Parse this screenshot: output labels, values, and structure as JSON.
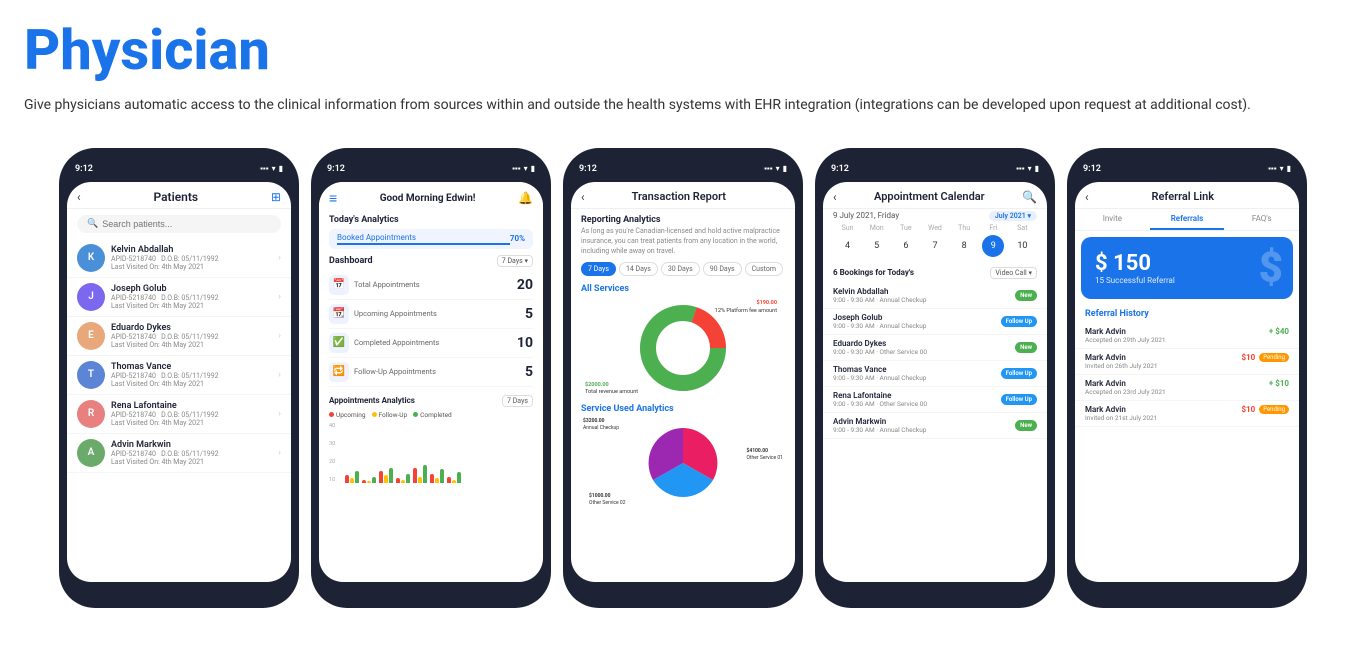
{
  "header": {
    "title": "Physician",
    "subtitle": "Give physicians automatic access to the clinical information from sources within and outside the health systems with EHR integration (integrations can be developed upon request at additional cost)."
  },
  "screens": [
    {
      "id": "patients",
      "time": "9:12",
      "title": "Patients",
      "search_placeholder": "Search patients...",
      "patients": [
        {
          "name": "Kelvin Abdallah",
          "id": "APID-5218740",
          "dob": "D.O.B: 05/11/1992",
          "last_visit": "Last Visited On: 4th May 2021",
          "color": "#4a90d9"
        },
        {
          "name": "Joseph Golub",
          "id": "APID-5218740",
          "dob": "D.O.B: 05/11/1992",
          "last_visit": "Last Visited On: 4th May 2021",
          "color": "#7b68ee"
        },
        {
          "name": "Eduardo Dykes",
          "id": "APID-5218740",
          "dob": "D.O.B: 05/11/1992",
          "last_visit": "Last Visited On: 4th May 2021",
          "color": "#e8a87c"
        },
        {
          "name": "Thomas Vance",
          "id": "APID-5218740",
          "dob": "D.O.B: 05/11/1992",
          "last_visit": "Last Visited On: 4th May 2021",
          "color": "#5c85d6"
        },
        {
          "name": "Rena Lafontaine",
          "id": "APID-5218740",
          "dob": "D.O.B: 05/11/1992",
          "last_visit": "Last Visited On: 4th May 2021",
          "color": "#e88080"
        },
        {
          "name": "Advin Markwin",
          "id": "APID-5218740",
          "dob": "D.O.B: 05/11/1992",
          "last_visit": "Last Visited On: 4th May 2021",
          "color": "#6aaa6a"
        }
      ]
    },
    {
      "id": "dashboard",
      "time": "9:12",
      "greeting": "Good Morning Edwin!",
      "analytics_title": "Today's Analytics",
      "booked_label": "Booked Appointments",
      "booked_pct": "70%",
      "dashboard_label": "Dashboard",
      "days_filter": "7 Days",
      "stats": [
        {
          "label": "Total Appointments",
          "value": "20",
          "icon": "📅"
        },
        {
          "label": "Upcoming Appointments",
          "value": "5",
          "icon": "📆"
        },
        {
          "label": "Completed Appointments",
          "value": "10",
          "icon": "✅"
        },
        {
          "label": "Follow-Up Appointments",
          "value": "5",
          "icon": "🔁"
        }
      ],
      "appointments_analytics_title": "Appointments Analytics",
      "appointments_days": "7 Days",
      "legend": [
        {
          "label": "Upcoming",
          "color": "#f44336"
        },
        {
          "label": "Follow-Up",
          "color": "#ffc107"
        },
        {
          "label": "Completed",
          "color": "#4caf50"
        }
      ],
      "y_axis": [
        "40",
        "30",
        "20",
        "10"
      ]
    },
    {
      "id": "transaction",
      "time": "9:12",
      "title": "Transaction Report",
      "reporting_label": "Reporting Analytics",
      "reporting_text": "As long as you're Canadian-licensed and hold active malpractice insurance, you can treat patients from any location in the world, including while away on travel.",
      "filter_tabs": [
        "7 Days",
        "14 Days",
        "30 Days",
        "90 Days",
        "Custom"
      ],
      "active_filter": "7 Days",
      "all_services_label": "All Services",
      "donut_labels": [
        {
          "text": "$190.00\n12% Platform fee amount",
          "pos": "top-right"
        },
        {
          "text": "$2000.00\nTotal revenue amount",
          "pos": "bottom-left"
        }
      ],
      "service_analytics_label": "Service Used Analytics",
      "pie_labels": [
        {
          "text": "$3200.00",
          "pos": "top"
        },
        {
          "text": "$4100.00\nOther Service 01",
          "pos": "right"
        },
        {
          "text": "$1000.00\nOther Service 02",
          "pos": "bottom"
        }
      ]
    },
    {
      "id": "calendar",
      "time": "9:12",
      "title": "Appointment Calendar",
      "date_display": "9 July 2021, Friday",
      "month_badge": "July 2021",
      "day_labels": [
        "Sun",
        "Mon",
        "Tue",
        "Wed",
        "Thu",
        "Fri",
        "Sat"
      ],
      "dates": [
        4,
        5,
        6,
        7,
        8,
        9,
        10
      ],
      "selected_date": 9,
      "bookings_count": "6 Bookings for Today's",
      "video_call": "Video Call",
      "bookings": [
        {
          "name": "Kelvin Abdallah",
          "time": "9:00 - 9:30 AM",
          "service": "Annual Checkup",
          "status": "New",
          "status_class": "status-new"
        },
        {
          "name": "Joseph Golub",
          "time": "9:00 - 9:30 AM",
          "service": "Annual Checkup",
          "status": "Follow Up",
          "status_class": "status-followup"
        },
        {
          "name": "Eduardo Dykes",
          "time": "9:00 - 9:30 AM",
          "service": "Other Service 00",
          "status": "New",
          "status_class": "status-new"
        },
        {
          "name": "Thomas Vance",
          "time": "9:00 - 9:30 AM",
          "service": "Annual Checkup",
          "status": "Follow Up",
          "status_class": "status-followup"
        },
        {
          "name": "Rena Lafontaine",
          "time": "9:00 - 9:30 AM",
          "service": "Other Service 00",
          "status": "Follow Up",
          "status_class": "status-followup"
        },
        {
          "name": "Advin Markwin",
          "time": "9:00 - 9:30 AM",
          "service": "Annual Checkup",
          "status": "New",
          "status_class": "status-new"
        }
      ]
    },
    {
      "id": "referral",
      "time": "9:12",
      "title": "Referral Link",
      "tabs": [
        "Invite",
        "Referrals",
        "FAQ's"
      ],
      "active_tab": "Referrals",
      "banner_amount": "$ 150",
      "banner_success": "15 Successful Referral",
      "history_title": "Referral History",
      "history_items": [
        {
          "name": "Mark Advin",
          "detail": "Accepted on 29th July 2021",
          "amount": "+ $40",
          "type": "positive"
        },
        {
          "name": "Mark Advin",
          "detail": "Invited on 26th July 2021",
          "amount": "$10",
          "type": "pending",
          "badge_label": "Pending",
          "badge_class": "badge-pending"
        },
        {
          "name": "Mark Advin",
          "detail": "Accepted on 23rd July 2021",
          "amount": "+ $10",
          "type": "positive"
        },
        {
          "name": "Mark Advin",
          "detail": "Invited on 21st July 2021",
          "amount": "$10",
          "type": "pending",
          "badge_label": "Pending",
          "badge_class": "badge-pending"
        }
      ]
    }
  ]
}
